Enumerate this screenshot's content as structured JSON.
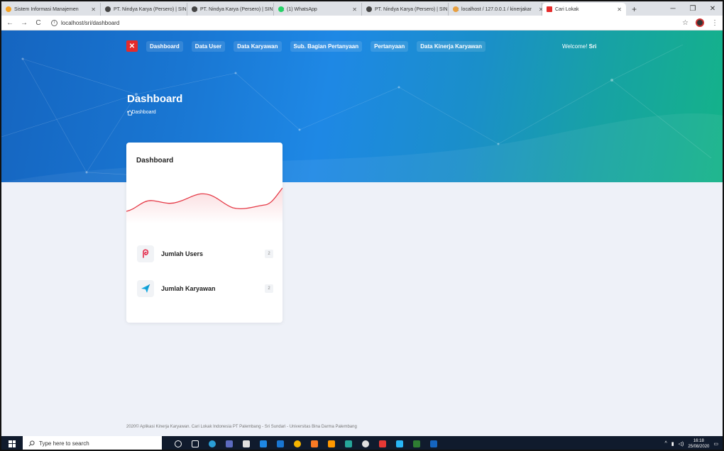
{
  "browser": {
    "tabs": [
      {
        "label": "Sistem Informasi Manajemen",
        "color": "#f4a020"
      },
      {
        "label": "PT. Nindya Karya (Persero) | SIN",
        "color": "#444"
      },
      {
        "label": "PT. Nindya Karya (Persero) | SIN",
        "color": "#444"
      },
      {
        "label": "(1) WhatsApp",
        "color": "#25d366"
      },
      {
        "label": "PT. Nindya Karya (Persero) | SIN",
        "color": "#444"
      },
      {
        "label": "localhost / 127.0.0.1 / kinerjakar",
        "color": "#e8a040"
      },
      {
        "label": "Cari Lokak",
        "color": "#e52b2b"
      }
    ],
    "url": "localhost/sri/dashboard"
  },
  "nav": {
    "items": [
      "Dashboard",
      "Data User",
      "Data Karyawan",
      "Sub. Bagian Pertanyaan",
      "Pertanyaan",
      "Data Kinerja Karyawan"
    ],
    "welcome_prefix": "Welcome!",
    "welcome_user": "Sri"
  },
  "hero": {
    "title": "Dashboard",
    "breadcrumb": "Dashboard"
  },
  "card": {
    "title": "Dashboard",
    "stats": [
      {
        "label": "Jumlah Users",
        "count": "2",
        "icon": "p-icon",
        "color": "#e52b4b"
      },
      {
        "label": "Jumlah Karyawan",
        "count": "2",
        "icon": "paper-plane-icon",
        "color": "#16a9e0"
      }
    ]
  },
  "footer": {
    "text": "2020© Aplikasi Kinerja Karyawan. Cari Lokak Indonesia PT Palembang - Sri Sundari - Universitas Bina Darma Palembang"
  },
  "taskbar": {
    "search_placeholder": "Type here to search",
    "time": "16:18",
    "date": "25/08/2020"
  }
}
